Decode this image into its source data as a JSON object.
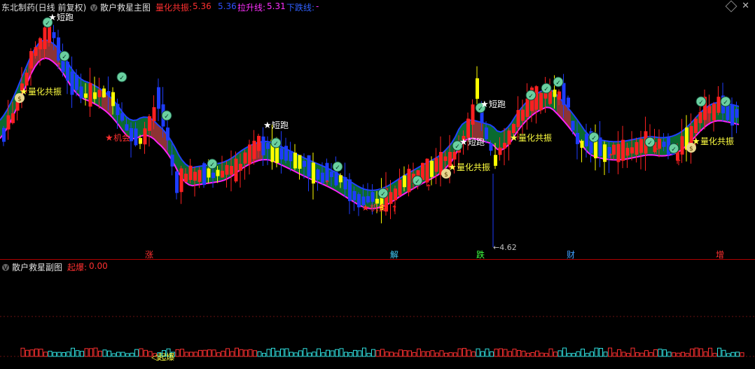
{
  "header": {
    "stock_title": "东北制药(日线 前复权)",
    "indicator_name": "散户救星主图",
    "lianghua_label": "量化共振:",
    "lianghua_value": "5.36",
    "second_value": "5.36",
    "lasheng_label": "拉升线:",
    "lasheng_value": "5.31",
    "xiadie_label": "下跌线:",
    "xiadie_value": "-"
  },
  "sub_header": {
    "indicator_name": "散户救星副图",
    "qibao_label": "起爆:",
    "qibao_value": "0.00"
  },
  "labels": {
    "lianghua": "量化共振",
    "duanpao": "短跑",
    "jihui": "机会",
    "qibao": "起爆",
    "min_price": "4.62"
  },
  "axis_markers": [
    {
      "text": "涨",
      "color": "#ff3030"
    },
    {
      "text": "解",
      "color": "#40d0ff"
    },
    {
      "text": "跌",
      "color": "#40ff40"
    },
    {
      "text": "财",
      "color": "#40a0ff"
    },
    {
      "text": "增",
      "color": "#ff3030"
    }
  ],
  "colors": {
    "up": "#ff2020",
    "down": "#1e3cff",
    "yellow": "#ffff00",
    "band_fill_green": "#0a6a30",
    "band_fill_red": "#8c3434",
    "upper_line": "#2040ff",
    "lower_line": "#ff20ff"
  },
  "icons": [
    "check-circle-icon",
    "money-bag-icon",
    "star-icon",
    "up-arrow-icon"
  ]
}
